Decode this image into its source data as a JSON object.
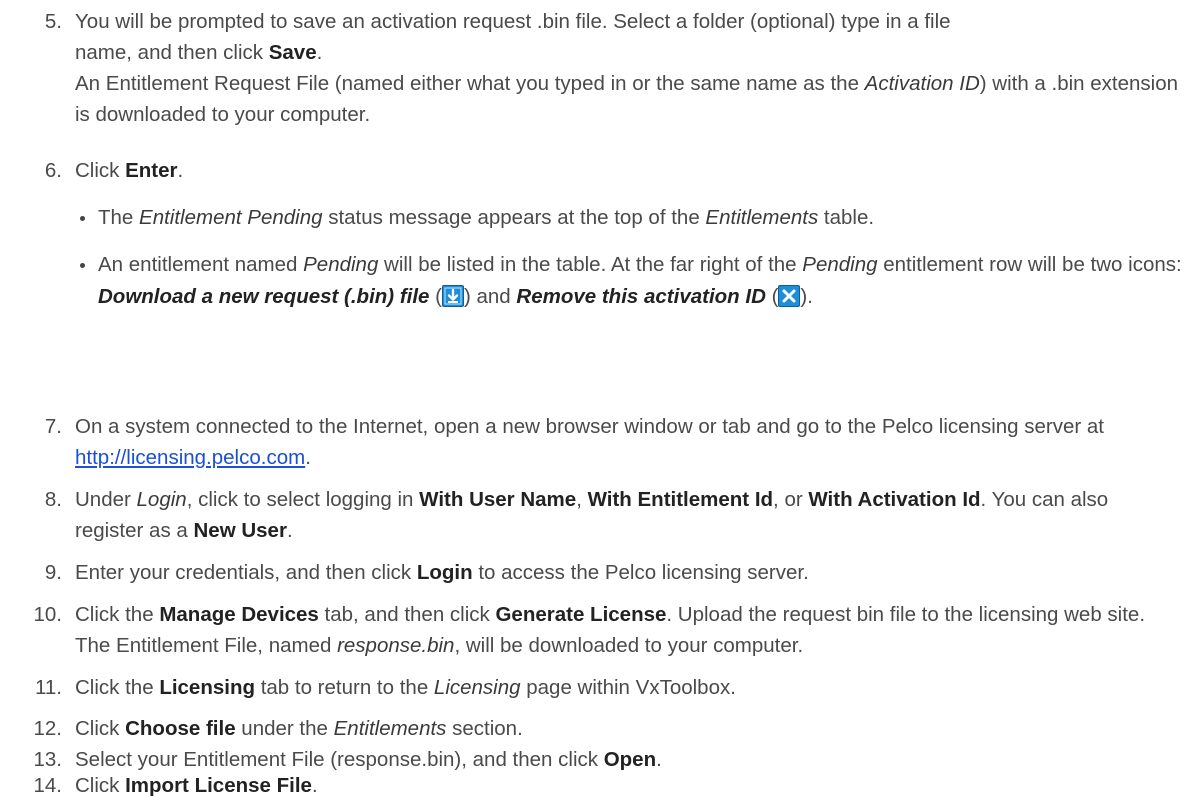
{
  "steps": [
    {
      "num": "5.",
      "l1a": "You will be prompted to save an activation request .bin file. Select a folder (optional) type in a file",
      "l1b": "name, and then click ",
      "save": "Save",
      "l1c": ".",
      "l2a": "An Entitlement Request File (named either what you typed in or the same name as the ",
      "activation_id": "Activation ID",
      "l2b": ") with a .bin extension is downloaded to your computer."
    },
    {
      "num": "6.",
      "a": "Click ",
      "enter": "Enter",
      "b": ".",
      "bullet1": {
        "i1": "Entitlement Pending",
        "t1": " status message appears at the top of the ",
        "pre": "The ",
        "i2": "Entitlements",
        "t2": " table."
      },
      "bullet2": {
        "pre": "An entitlement named ",
        "i1": "Pending",
        "t1": " will be listed in the table. At the far right of the ",
        "i2": "Pending",
        "t2": " entitlement row will be two icons: ",
        "bi1": "Download a new request (.bin) file",
        "t3": " (",
        "t4": ") and ",
        "bi2": "Remove this activation ID",
        "t5": " (",
        "t6": ")."
      }
    },
    {
      "num": "7.",
      "a": "On a system connected to the Internet, open a new browser window or tab and go to the Pelco licensing server at ",
      "link": "http://licensing.pelco.com",
      "b": "."
    },
    {
      "num": "8.",
      "a": "Under ",
      "login_i": "Login",
      "b": ", click to select logging in ",
      "opt1": "With User Name",
      "c": ", ",
      "opt2": "With Entitlement Id",
      "d": ", or ",
      "opt3": "With Activation Id",
      "e": ". You can also register as a ",
      "opt4": "New User",
      "f": "."
    },
    {
      "num": "9.",
      "a": "Enter your credentials, and then click ",
      "login": "Login",
      "b": " to access the Pelco licensing server."
    },
    {
      "num": "10.",
      "a": "Click the ",
      "b1": "Manage Devices",
      "b": " tab, and then click ",
      "b2": "Generate License",
      "c": ". Upload the request bin file to the licensing web site. The Entitlement File, named ",
      "i1": "response.bin",
      "d": ", will be downloaded to your computer."
    },
    {
      "num": "11.",
      "a": "Click the ",
      "b1": "Licensing",
      "b": " tab to return to the ",
      "i1": "Licensing",
      "c": " page within VxToolbox."
    },
    {
      "num": "12.",
      "a": "Click ",
      "b1": "Choose file",
      "b": " under the ",
      "i1": "Entitlements",
      "c": " section."
    },
    {
      "num": "13.",
      "a": "Select your Entitlement File (response.bin), and then click ",
      "b1": "Open",
      "b": "."
    },
    {
      "num": "14.",
      "a": "Click ",
      "b1": "Import License File",
      "b": "."
    }
  ],
  "icons": {
    "download": {
      "name": "download-icon",
      "color": "#1e8fd6"
    },
    "remove": {
      "name": "remove-icon",
      "color": "#1e8fd6"
    }
  }
}
